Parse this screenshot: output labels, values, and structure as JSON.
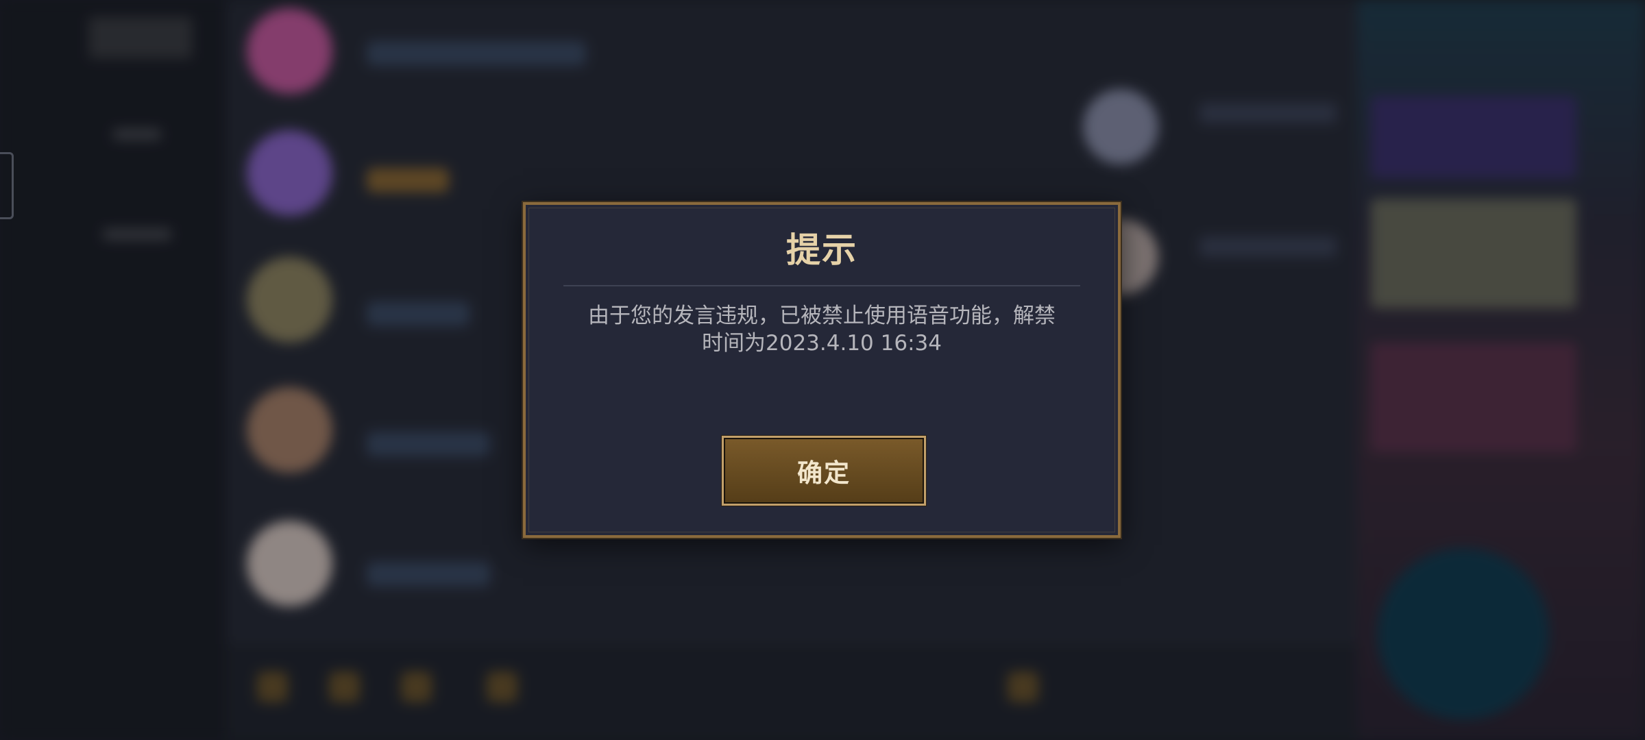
{
  "dialog": {
    "title": "提示",
    "message_line1": "由于您的发言违规，已被禁止使用语音功能，解禁",
    "message_line2": "时间为2023.4.10 16:34",
    "confirm_label": "确定"
  },
  "colors": {
    "dialog_background": "#252838",
    "dialog_border": "#8a6a3c",
    "title_color": "#e6d2a8",
    "button_fill": "#654a20",
    "button_border": "#c2a06a"
  }
}
